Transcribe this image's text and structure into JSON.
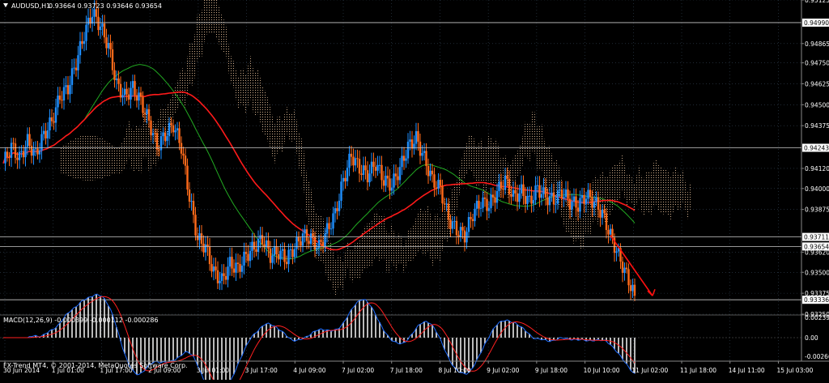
{
  "header": {
    "symbol": "AUDUSD,H1",
    "ohlc": "0.93664 0.93723 0.93646 0.93654",
    "macd_label": "MACD(12,26,9) -0.000399 -0.000112 -0.000286",
    "copyright": "FX-Trend MT4, © 2001-2014, MetaQuotes Software Corp."
  },
  "colors": {
    "background": "#000000",
    "grid": "#334455",
    "bull_candle": "#1e90ff",
    "bear_candle": "#ff6a1a",
    "ma_red": "#ff1a1a",
    "ma_green": "#22aa22",
    "cloud": "#f0c8a0",
    "arrow": "#ff1010",
    "macd_hist": "#e8e8e8",
    "macd_main": "#1e6cff",
    "macd_signal": "#ff2020"
  },
  "chart_data": {
    "type": "candlestick",
    "symbol": "AUDUSD",
    "timeframe": "H1",
    "ylim": [
      0.9325,
      0.95125
    ],
    "y_ticks": [
      "0.95125",
      "0.94865",
      "0.94750",
      "0.94625",
      "0.94500",
      "0.94375",
      "0.94120",
      "0.94000",
      "0.93875",
      "0.93620",
      "0.93500",
      "0.93375",
      "0.93250"
    ],
    "x_ticks": [
      "30 Jun 2014",
      "1 Jul 01:00",
      "1 Jul 17:00",
      "2 Jul 09:00",
      "3 Jul 01:00",
      "3 Jul 17:00",
      "4 Jul 09:00",
      "7 Jul 02:00",
      "7 Jul 18:00",
      "8 Jul 10:00",
      "9 Jul 02:00",
      "9 Jul 18:00",
      "10 Jul 10:00",
      "11 Jul 02:00",
      "11 Jul 18:00",
      "14 Jul 11:00",
      "15 Jul 03:00"
    ],
    "price_levels": [
      {
        "value": 0.9499,
        "label": "0.94990"
      },
      {
        "value": 0.94243,
        "label": "0.94243"
      },
      {
        "value": 0.93711,
        "label": "0.93711"
      },
      {
        "value": 0.93654,
        "label": "0.93654"
      },
      {
        "value": 0.93336,
        "label": "0.93336"
      }
    ],
    "close_path": [
      0.9415,
      0.9425,
      0.9418,
      0.9428,
      0.942,
      0.9432,
      0.944,
      0.9455,
      0.946,
      0.9475,
      0.9492,
      0.9505,
      0.9497,
      0.9485,
      0.9462,
      0.9455,
      0.946,
      0.9452,
      0.944,
      0.9425,
      0.9432,
      0.9438,
      0.9425,
      0.9395,
      0.937,
      0.9365,
      0.935,
      0.9345,
      0.9355,
      0.9352,
      0.936,
      0.9365,
      0.937,
      0.936,
      0.9362,
      0.9358,
      0.9365,
      0.9372,
      0.937,
      0.9365,
      0.9375,
      0.9385,
      0.9405,
      0.942,
      0.9412,
      0.9408,
      0.9415,
      0.9405,
      0.9402,
      0.9412,
      0.9425,
      0.943,
      0.9418,
      0.9405,
      0.94,
      0.9382,
      0.9375,
      0.9372,
      0.9385,
      0.9392,
      0.939,
      0.9398,
      0.9405,
      0.9395,
      0.9398,
      0.9392,
      0.94,
      0.9395,
      0.9393,
      0.9398,
      0.9392,
      0.939,
      0.9396,
      0.9392,
      0.9385,
      0.9372,
      0.936,
      0.9348,
      0.9336
    ],
    "macd_ylim": [
      -0.00266,
      0.00239
    ],
    "macd_y_ticks": [
      "0.00239",
      "0.00",
      "-0.00266"
    ]
  }
}
